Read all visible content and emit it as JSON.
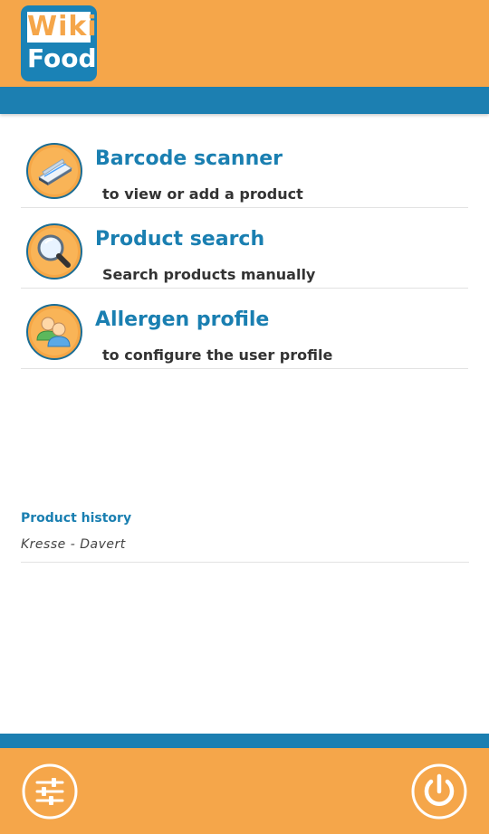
{
  "app": {
    "logo_text_top": "Wiki",
    "logo_text_bottom": "Food"
  },
  "menu": {
    "items": [
      {
        "title": "Barcode scanner",
        "subtitle": "to view or add a product",
        "icon": "scanner-icon"
      },
      {
        "title": "Product search",
        "subtitle": "Search products manually",
        "icon": "magnifier-icon"
      },
      {
        "title": "Allergen profile",
        "subtitle": "to configure the user profile",
        "icon": "users-icon"
      }
    ]
  },
  "history": {
    "title": "Product history",
    "items": [
      "Kresse - Davert"
    ]
  },
  "footer": {
    "settings_icon": "sliders-icon",
    "power_icon": "power-icon"
  },
  "colors": {
    "brand_orange": "#f5a64a",
    "brand_blue": "#1c7fb1",
    "title_blue": "#1a7fb1"
  }
}
